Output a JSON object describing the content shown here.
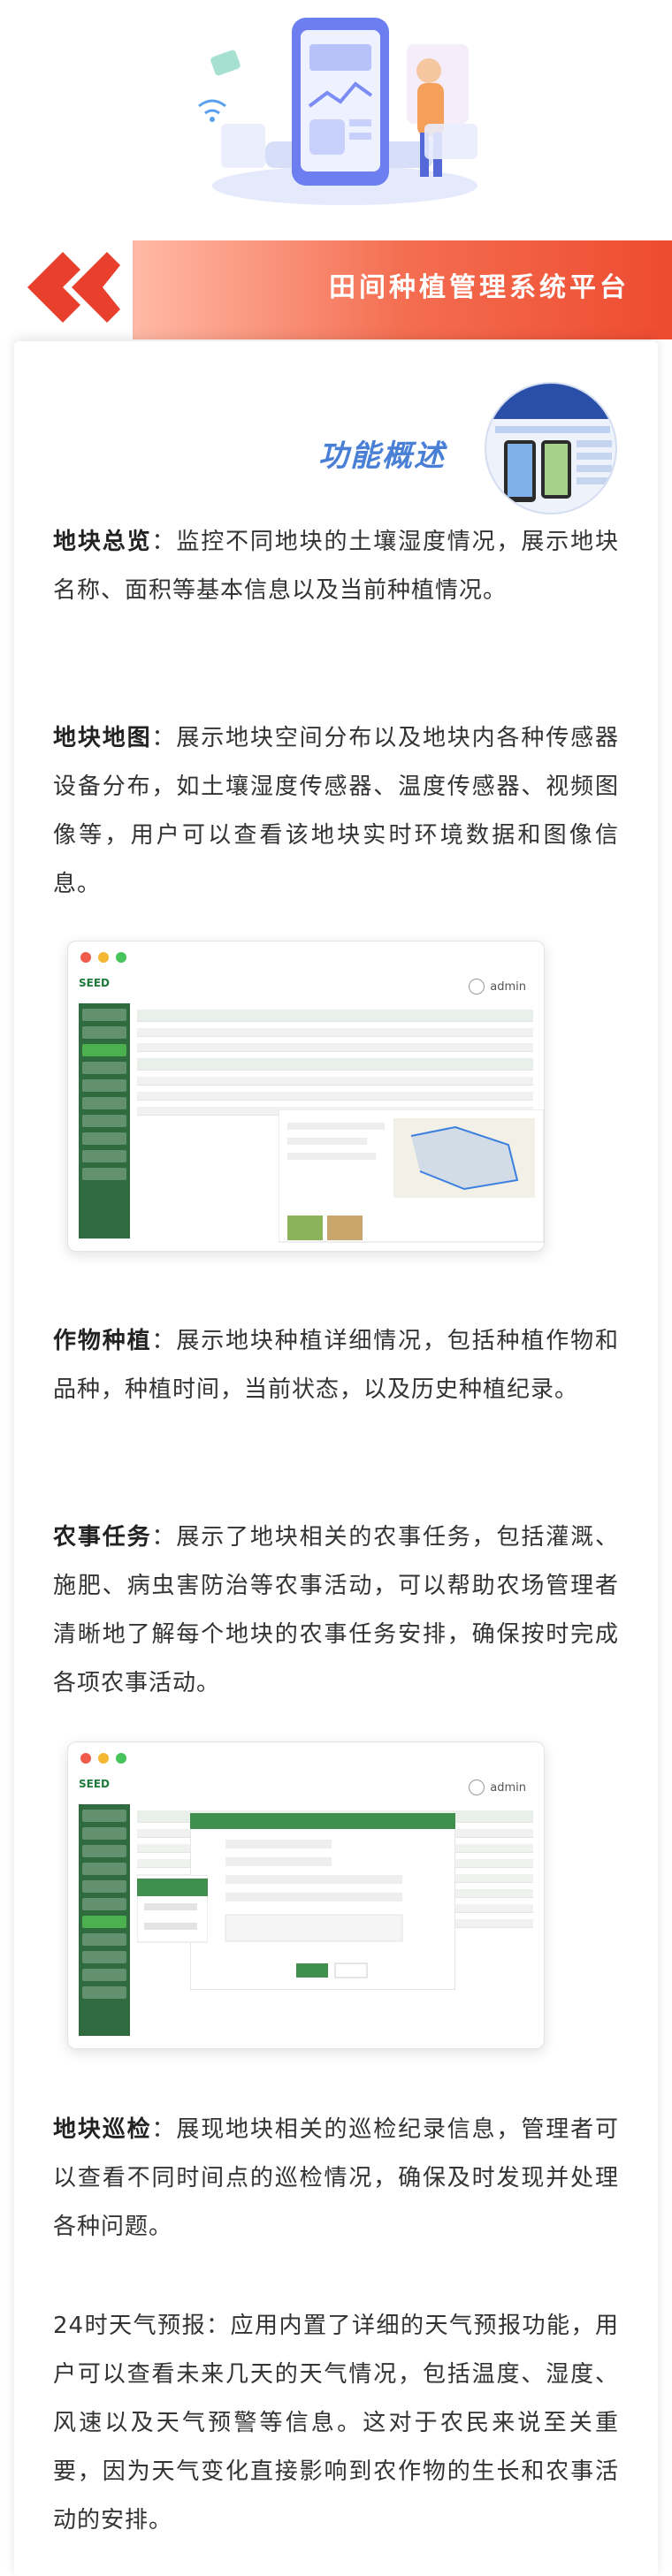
{
  "banner": {
    "title": "田间种植管理系统平台"
  },
  "intro": {
    "section_title": "功能概述"
  },
  "features": [
    {
      "label": "地块总览",
      "sep": "：",
      "text": "监控不同地块的土壤湿度情况，展示地块名称、面积等基本信息以及当前种植情况。"
    },
    {
      "label": "地块地图",
      "sep": "：",
      "text": "展示地块空间分布以及地块内各种传感器设备分布，如土壤湿度传感器、温度传感器、视频图像等，用户可以查看该地块实时环境数据和图像信息。"
    },
    {
      "label": "作物种植",
      "sep": "：",
      "text": "展示地块种植详细情况，包括种植作物和品种，种植时间，当前状态，以及历史种植纪录。"
    },
    {
      "label": "农事任务",
      "sep": "：",
      "text": "展示了地块相关的农事任务，包括灌溉、施肥、病虫害防治等农事活动，可以帮助农场管理者清晰地了解每个地块的农事任务安排，确保按时完成各项农事活动。"
    },
    {
      "label": "地块巡检",
      "sep": "：",
      "text": "展现地块相关的巡检纪录信息，管理者可以查看不同时间点的巡检情况，确保及时发现并处理各种问题。"
    },
    {
      "label": "",
      "sep": "",
      "text": "24时天气预报：应用内置了详细的天气预报功能，用户可以查看未来几天的天气情况，包括温度、湿度、风速以及天气预警等信息。这对于农民来说至关重要，因为天气变化直接影响到农作物的生长和农事活动的安排。"
    }
  ],
  "screens": [
    {
      "app_logo": "SEED",
      "user": "admin"
    },
    {
      "app_logo": "SEED",
      "user": "admin"
    }
  ],
  "colors": {
    "accent": "#f06040",
    "title_blue": "#4a7fd6",
    "sidebar_green": "#2f6b3e"
  }
}
